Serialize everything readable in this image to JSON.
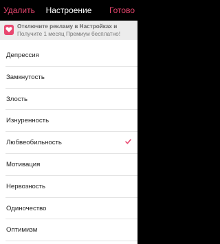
{
  "navbar": {
    "left_label": "Удалить",
    "title": "Настроение",
    "right_label": "Готово"
  },
  "promo": {
    "icon": "heart-icon",
    "title": "Отключите рекламу в Настройках и",
    "subtitle": "Получите 1 месяц Премиум бесплатно!"
  },
  "moods": [
    {
      "label": "Депрессия",
      "selected": false
    },
    {
      "label": "Замкнутость",
      "selected": false
    },
    {
      "label": "Злость",
      "selected": false
    },
    {
      "label": "Изнуренность",
      "selected": false
    },
    {
      "label": "Любвеобильность",
      "selected": true
    },
    {
      "label": "Мотивация",
      "selected": false
    },
    {
      "label": "Нервозность",
      "selected": false
    },
    {
      "label": "Одиночество",
      "selected": false
    },
    {
      "label": "Оптимизм",
      "selected": false
    }
  ],
  "colors": {
    "accent": "#e8476f",
    "navbar_bg": "#000000",
    "promo_bg": "#ececec",
    "list_bg": "#ffffff"
  }
}
